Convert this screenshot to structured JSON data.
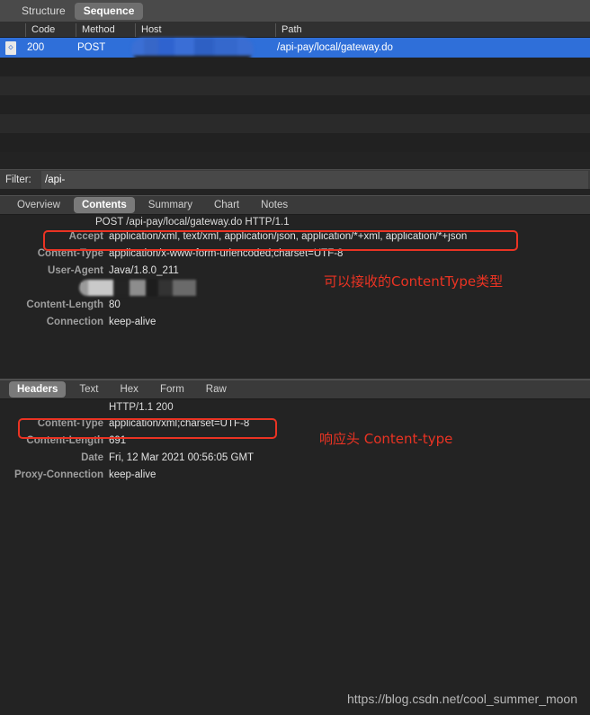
{
  "top_bar": {
    "structure_label": "Structure",
    "sequence_label": "Sequence"
  },
  "table": {
    "columns": {
      "code": "Code",
      "method": "Method",
      "host": "Host",
      "path": "Path"
    },
    "selected_row": {
      "icon": "document-icon",
      "code": "200",
      "method": "POST",
      "host": "",
      "path": "/api-pay/local/gateway.do"
    }
  },
  "filter": {
    "label": "Filter:",
    "value": "/api-",
    "placeholder": ""
  },
  "request_tabs": [
    {
      "label": "Overview",
      "active": false
    },
    {
      "label": "Contents",
      "active": true
    },
    {
      "label": "Summary",
      "active": false
    },
    {
      "label": "Chart",
      "active": false
    },
    {
      "label": "Notes",
      "active": false
    }
  ],
  "request": {
    "request_line": "POST /api-pay/local/gateway.do HTTP/1.1",
    "headers": [
      {
        "name": "Accept",
        "value": "application/xml, text/xml, application/json, application/*+xml, application/*+json"
      },
      {
        "name": "Content-Type",
        "value": "application/x-www-form-urlencoded;charset=UTF-8"
      },
      {
        "name": "User-Agent",
        "value": "Java/1.8.0_211"
      },
      {
        "name": "Host",
        "value": ""
      },
      {
        "name": "Content-Length",
        "value": "80"
      },
      {
        "name": "Connection",
        "value": "keep-alive"
      }
    ]
  },
  "response_tabs": [
    {
      "label": "Headers",
      "active": true
    },
    {
      "label": "Text",
      "active": false
    },
    {
      "label": "Hex",
      "active": false
    },
    {
      "label": "Form",
      "active": false
    },
    {
      "label": "Raw",
      "active": false
    }
  ],
  "response": {
    "status_line": "HTTP/1.1 200",
    "headers": [
      {
        "name": "Content-Type",
        "value": "application/xml;charset=UTF-8"
      },
      {
        "name": "Content-Length",
        "value": "691"
      },
      {
        "name": "Date",
        "value": "Fri, 12 Mar 2021 00:56:05 GMT"
      },
      {
        "name": "Proxy-Connection",
        "value": "keep-alive"
      }
    ]
  },
  "annotations": [
    {
      "text": "可以接收的ContentType类型",
      "color": "#ea3323"
    },
    {
      "text": "响应头 Content-type",
      "color": "#ea3323"
    }
  ],
  "watermark": "https://blog.csdn.net/cool_summer_moon",
  "colors": {
    "selection_blue": "#2f6fd9",
    "annotation_red": "#ea3323",
    "window_bg": "#232323",
    "toolbar_bg": "#4a4a4a"
  }
}
